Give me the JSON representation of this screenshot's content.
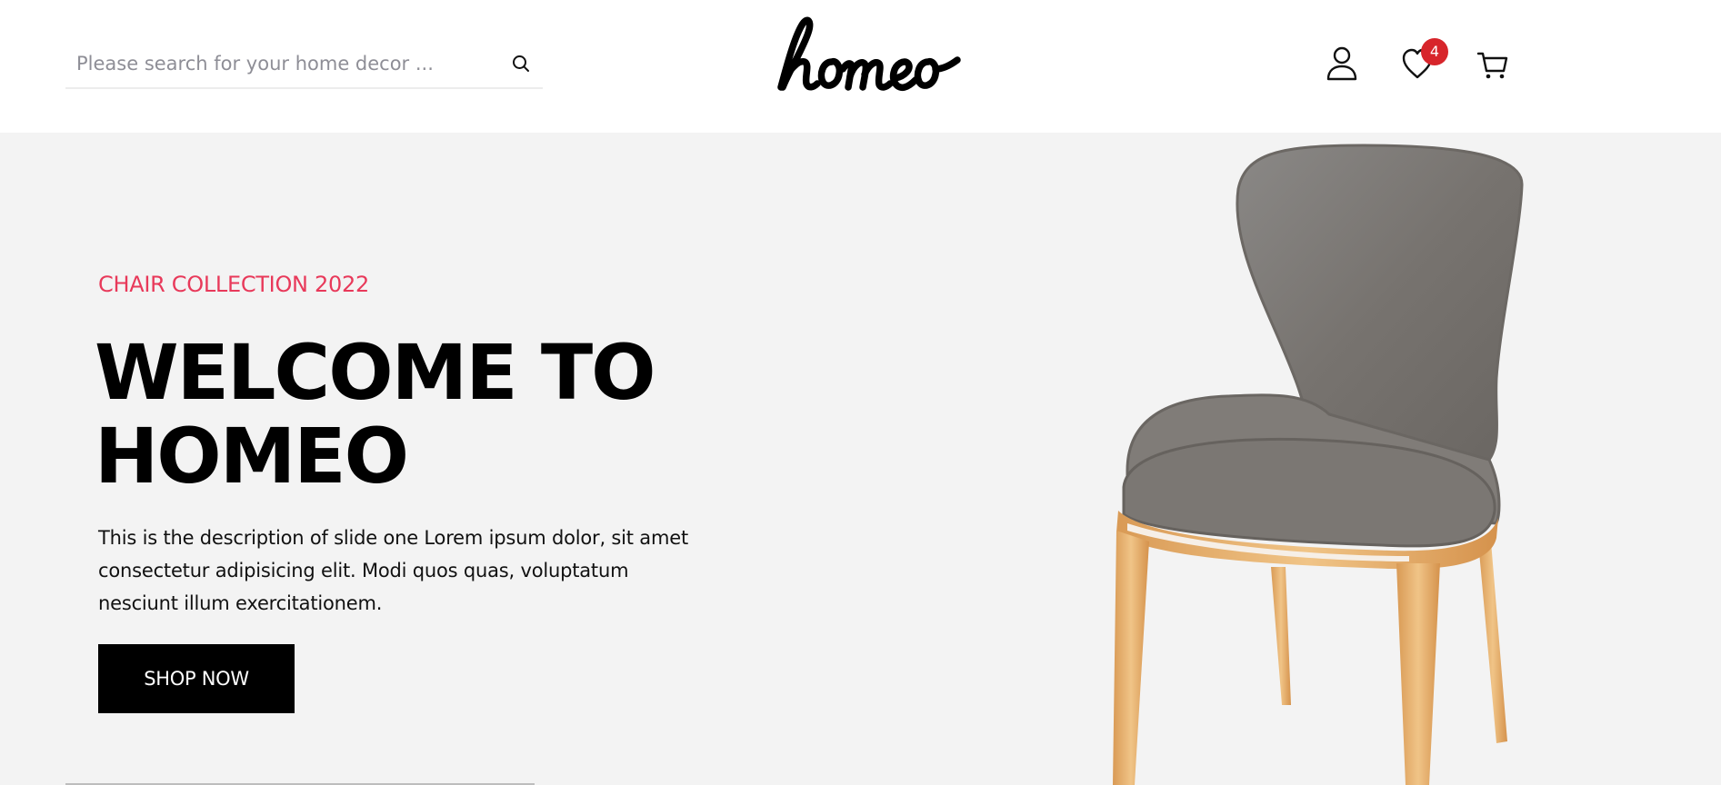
{
  "header": {
    "search": {
      "placeholder": "Please search for your home decor ...",
      "icon": "search-icon"
    },
    "logo_text": "homeo",
    "icons": {
      "account": "user-icon",
      "wishlist": "heart-icon",
      "cart": "cart-icon"
    },
    "wishlist_count": "4"
  },
  "hero": {
    "subtitle": "CHAIR COLLECTION 2022",
    "title": "WELCOME TO HOMEO",
    "description": "This is the description of slide one Lorem ipsum dolor, sit amet consectetur adipisicing elit. Modi quos quas, voluptatum nesciunt illum exercitationem.",
    "cta_label": "SHOP NOW",
    "image": "chair-image"
  },
  "colors": {
    "accent": "#e8395a",
    "badge": "#d7252b",
    "hero_bg": "#f3f3f3",
    "button_bg": "#000000",
    "button_text": "#ffffff"
  }
}
